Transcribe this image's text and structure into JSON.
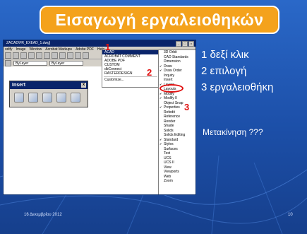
{
  "slide": {
    "title": "Εισαγωγή εργαλειοθηκών",
    "steps": [
      "1 δεξί κλικ",
      "2 επιλογή",
      "3 εργαλειοθήκη"
    ],
    "note": "Μετακίνηση ???",
    "footer_date": "16 Δεκεμβρίου 2012",
    "page_number": "10",
    "colors": {
      "background": "#1f57b5",
      "title_fill": "#f4a21c",
      "marker": "#e01010",
      "text": "#ffffff"
    }
  },
  "app": {
    "window_title": "ZACAD\\FR_EXEAD_1.dwg]",
    "window_buttons": [
      "_",
      "□",
      "x"
    ],
    "menu": [
      "odify",
      "Image",
      "Window",
      "Acrobat Markups",
      "Adobe PDF",
      "Help"
    ],
    "layer_combo": "ByLayer",
    "linetype_combo": "ByLayer"
  },
  "insert_toolbar": {
    "title": "Insert",
    "close_label": "x",
    "icons": [
      "insert-block-icon",
      "external-reference-icon",
      "raster-image-icon",
      "insert-object-icon",
      "insert-layout-icon"
    ]
  },
  "context_menu": {
    "items": [
      "ACAD",
      "ACROBAT COMMENT",
      "ADOBE PDF",
      "CUSTOM",
      "dbConnect",
      "RASTERDESIGN",
      "Customize..."
    ],
    "selected": "ACAD"
  },
  "sub_menu": {
    "items": [
      {
        "label": "3D Orbit",
        "checked": false
      },
      {
        "label": "CAD Standards",
        "checked": false
      },
      {
        "label": "Dimension",
        "checked": false
      },
      {
        "label": "Draw",
        "checked": true
      },
      {
        "label": "Draw Order",
        "checked": true
      },
      {
        "label": "Inquiry",
        "checked": false
      },
      {
        "label": "Insert",
        "checked": false
      },
      {
        "label": "Layers",
        "checked": true
      },
      {
        "label": "Layouts",
        "checked": false
      },
      {
        "label": "Modify",
        "checked": true
      },
      {
        "label": "Modify II",
        "checked": true
      },
      {
        "label": "Object Snap",
        "checked": false
      },
      {
        "label": "Properties",
        "checked": true
      },
      {
        "label": "Refedit",
        "checked": false
      },
      {
        "label": "Reference",
        "checked": false
      },
      {
        "label": "Render",
        "checked": false
      },
      {
        "label": "Shade",
        "checked": false
      },
      {
        "label": "Solids",
        "checked": false
      },
      {
        "label": "Solids Editing",
        "checked": false
      },
      {
        "label": "Standard",
        "checked": true
      },
      {
        "label": "Styles",
        "checked": true
      },
      {
        "label": "Surfaces",
        "checked": false
      },
      {
        "label": "Text",
        "checked": false
      },
      {
        "label": "UCS",
        "checked": false
      },
      {
        "label": "UCS II",
        "checked": false
      },
      {
        "label": "View",
        "checked": false
      },
      {
        "label": "Viewports",
        "checked": false
      },
      {
        "label": "Web",
        "checked": false
      },
      {
        "label": "Zoom",
        "checked": false
      }
    ]
  },
  "markers": [
    "1",
    "2",
    "3"
  ]
}
